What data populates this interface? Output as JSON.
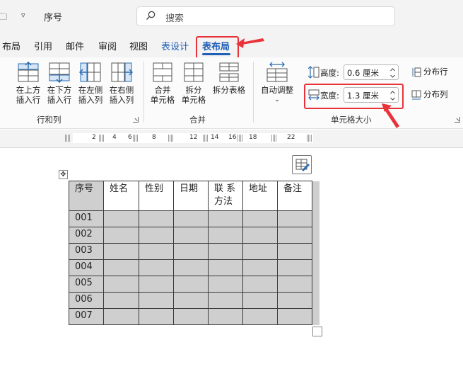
{
  "titlebar": {
    "doc_name": "序号",
    "search_placeholder": "搜索"
  },
  "tabs": [
    {
      "label": "布局"
    },
    {
      "label": "引用"
    },
    {
      "label": "邮件"
    },
    {
      "label": "审阅"
    },
    {
      "label": "视图"
    },
    {
      "label": "表设计"
    },
    {
      "label": "表布局"
    }
  ],
  "ribbon": {
    "rows_cols": {
      "label": "行和列",
      "buttons": [
        {
          "line1": "在上方",
          "line2": "插入行"
        },
        {
          "line1": "在下方",
          "line2": "插入行"
        },
        {
          "line1": "在左侧",
          "line2": "插入列"
        },
        {
          "line1": "在右侧",
          "line2": "插入列"
        }
      ]
    },
    "merge": {
      "label": "合并",
      "buttons": [
        {
          "line1": "合并",
          "line2": "单元格"
        },
        {
          "line1": "拆分",
          "line2": "单元格"
        },
        {
          "line1": "拆分表格",
          "line2": ""
        }
      ]
    },
    "cell_size": {
      "label": "单元格大小",
      "autofit_label": "自动调整",
      "height_label": "高度:",
      "height_value": "0.6 厘米",
      "width_label": "宽度:",
      "width_value": "1.3 厘米",
      "distribute_rows": "分布行",
      "distribute_cols": "分布列"
    }
  },
  "ruler": {
    "numbers": [
      "2",
      "4",
      "6",
      "8",
      "12",
      "14",
      "16",
      "18",
      "22"
    ]
  },
  "table": {
    "headers": [
      {
        "line1": "序号",
        "line2": ""
      },
      {
        "line1": "姓名",
        "line2": ""
      },
      {
        "line1": "性别",
        "line2": ""
      },
      {
        "line1": "日期",
        "line2": ""
      },
      {
        "line1": "联 系",
        "line2": "方法"
      },
      {
        "line1": "地址",
        "line2": ""
      },
      {
        "line1": "备注",
        "line2": ""
      }
    ],
    "rows": [
      "001",
      "002",
      "003",
      "004",
      "005",
      "006",
      "007"
    ]
  },
  "colors": {
    "accent": "#1f5fb8",
    "annotation_red": "#e8333a",
    "cell_gray": "#cfcfcf"
  }
}
